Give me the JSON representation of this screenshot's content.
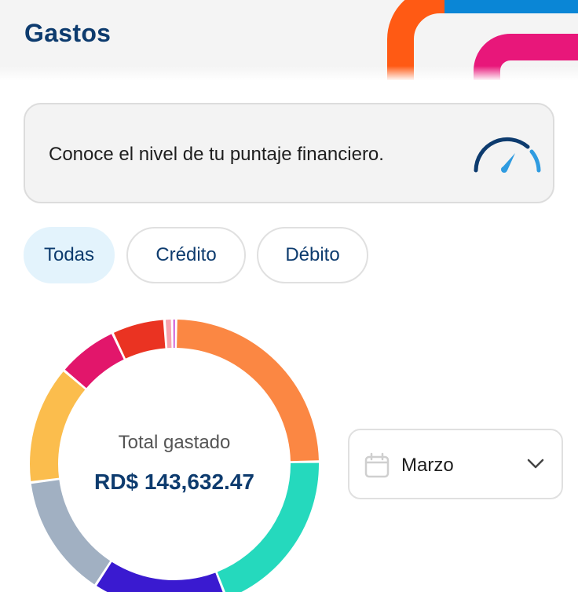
{
  "header": {
    "title": "Gastos"
  },
  "score_card": {
    "text": "Conoce el nivel de tu puntaje financiero."
  },
  "filters": [
    {
      "label": "Todas",
      "active": true
    },
    {
      "label": "Crédito",
      "active": false
    },
    {
      "label": "Débito",
      "active": false
    }
  ],
  "summary": {
    "total_label": "Total gastado",
    "total_value": "RD$ 143,632.47"
  },
  "month_selector": {
    "value": "Marzo",
    "icon": "calendar-icon",
    "chevron": "chevron-down-icon"
  },
  "colors": {
    "brand_navy": "#0d3b6e",
    "active_filter_bg": "#e3f3fc",
    "gauge_accent": "#2f9be0"
  },
  "chart_data": {
    "type": "pie",
    "style": "donut",
    "slices": [
      {
        "color": "#fb8743",
        "share": 0.228
      },
      {
        "color": "#25d9bd",
        "share": 0.18
      },
      {
        "color": "#3a1ad0",
        "share": 0.14
      },
      {
        "color": "#a1b0c2",
        "share": 0.128
      },
      {
        "color": "#fbbd4d",
        "share": 0.123
      },
      {
        "color": "#e2166b",
        "share": 0.063
      },
      {
        "color": "#ea3322",
        "share": 0.055
      },
      {
        "color": "#f7a3af",
        "share": 0.008
      },
      {
        "color": "#c22cc8",
        "share": 0.004
      }
    ]
  }
}
